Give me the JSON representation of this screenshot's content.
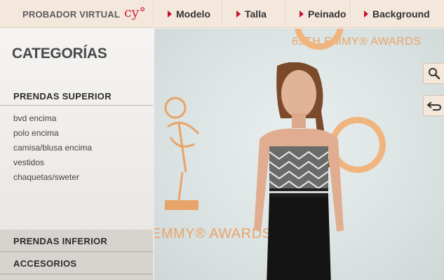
{
  "header": {
    "brand_label": "PROBADOR VIRTUAL",
    "brand_logo": "cy°",
    "nav": [
      {
        "label": "Modelo"
      },
      {
        "label": "Talla"
      },
      {
        "label": "Peinado"
      },
      {
        "label": "Background"
      }
    ]
  },
  "sidebar": {
    "title": "CATEGORÍAS",
    "sections": [
      {
        "label": "PRENDAS SUPERIOR",
        "items": [
          "bvd encima",
          "polo encima",
          "camisa/blusa encima",
          "vestidos",
          "chaquetas/sweter"
        ]
      },
      {
        "label": "PRENDAS INFERIOR"
      },
      {
        "label": "ACCESORIOS"
      }
    ]
  },
  "stage": {
    "backdrop_top": "65TH EMMY® AWARDS",
    "backdrop_bottom": "EMMY® AWARDS"
  },
  "tools": {
    "search_icon": "magnifier-icon",
    "undo_icon": "undo-arrow-icon"
  },
  "colors": {
    "accent": "#c8102e",
    "topbar": "#f4e7dc",
    "backdrop_orange": "#e8a468"
  }
}
